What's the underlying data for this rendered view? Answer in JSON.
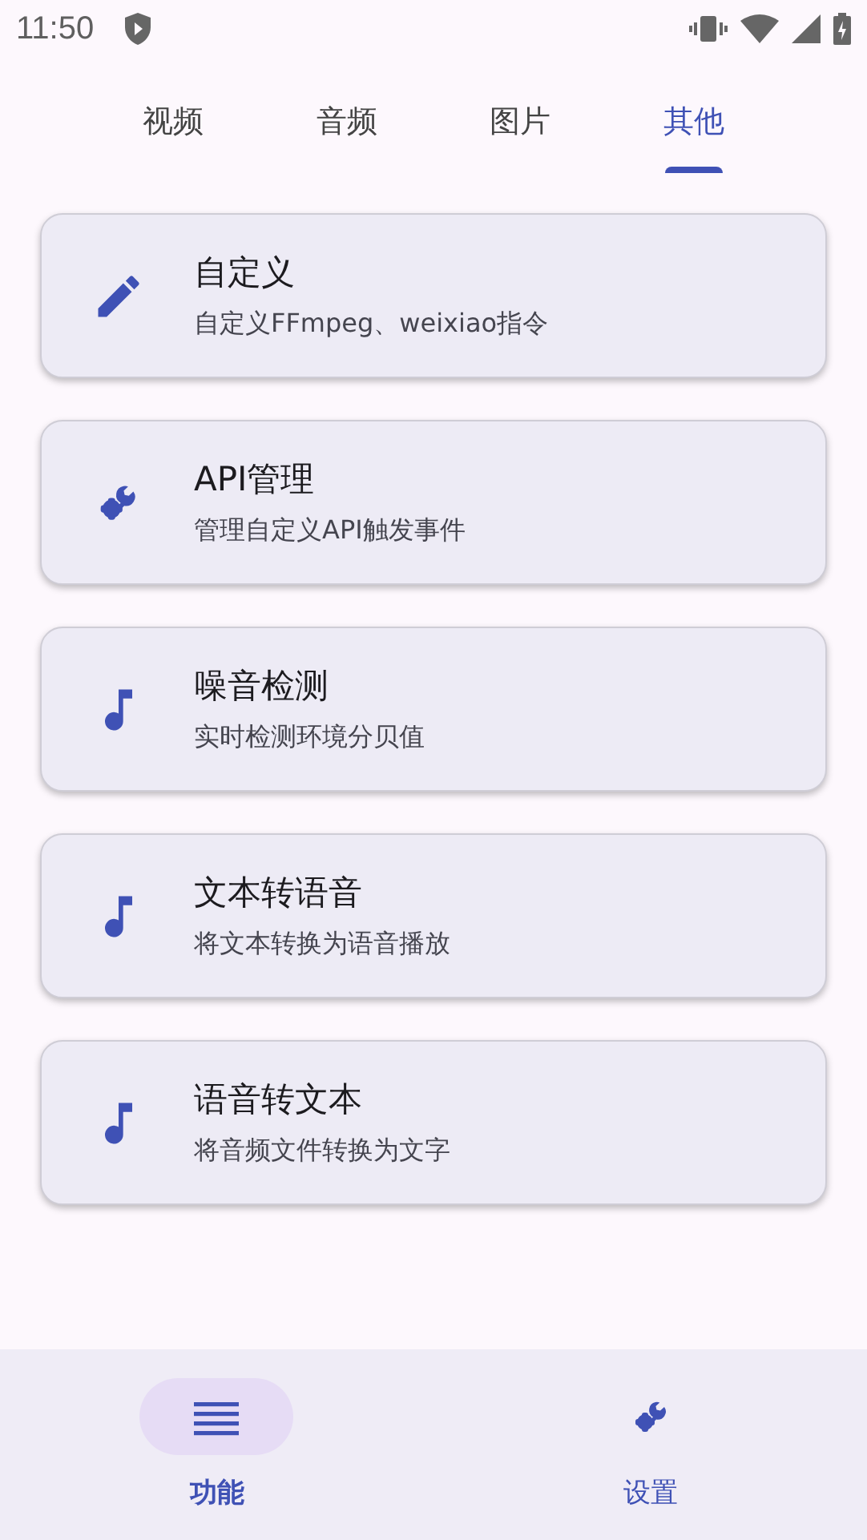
{
  "status_bar": {
    "time": "11:50"
  },
  "tabs": [
    {
      "label": "视频",
      "selected": false
    },
    {
      "label": "音频",
      "selected": false
    },
    {
      "label": "图片",
      "selected": false
    },
    {
      "label": "其他",
      "selected": true
    }
  ],
  "items": [
    {
      "kind": "pencil",
      "title": "自定义",
      "subtitle": "自定义FFmpeg、weixiao指令"
    },
    {
      "kind": "tools",
      "title": "API管理",
      "subtitle": "管理自定义API触发事件"
    },
    {
      "kind": "music",
      "title": "噪音检测",
      "subtitle": "实时检测环境分贝值"
    },
    {
      "kind": "music",
      "title": "文本转语音",
      "subtitle": "将文本转换为语音播放"
    },
    {
      "kind": "music",
      "title": "语音转文本",
      "subtitle": "将音频文件转换为文字"
    }
  ],
  "bottom_nav": [
    {
      "kind": "menu",
      "label": "功能",
      "selected": true
    },
    {
      "kind": "tools",
      "label": "设置",
      "selected": false
    }
  ]
}
